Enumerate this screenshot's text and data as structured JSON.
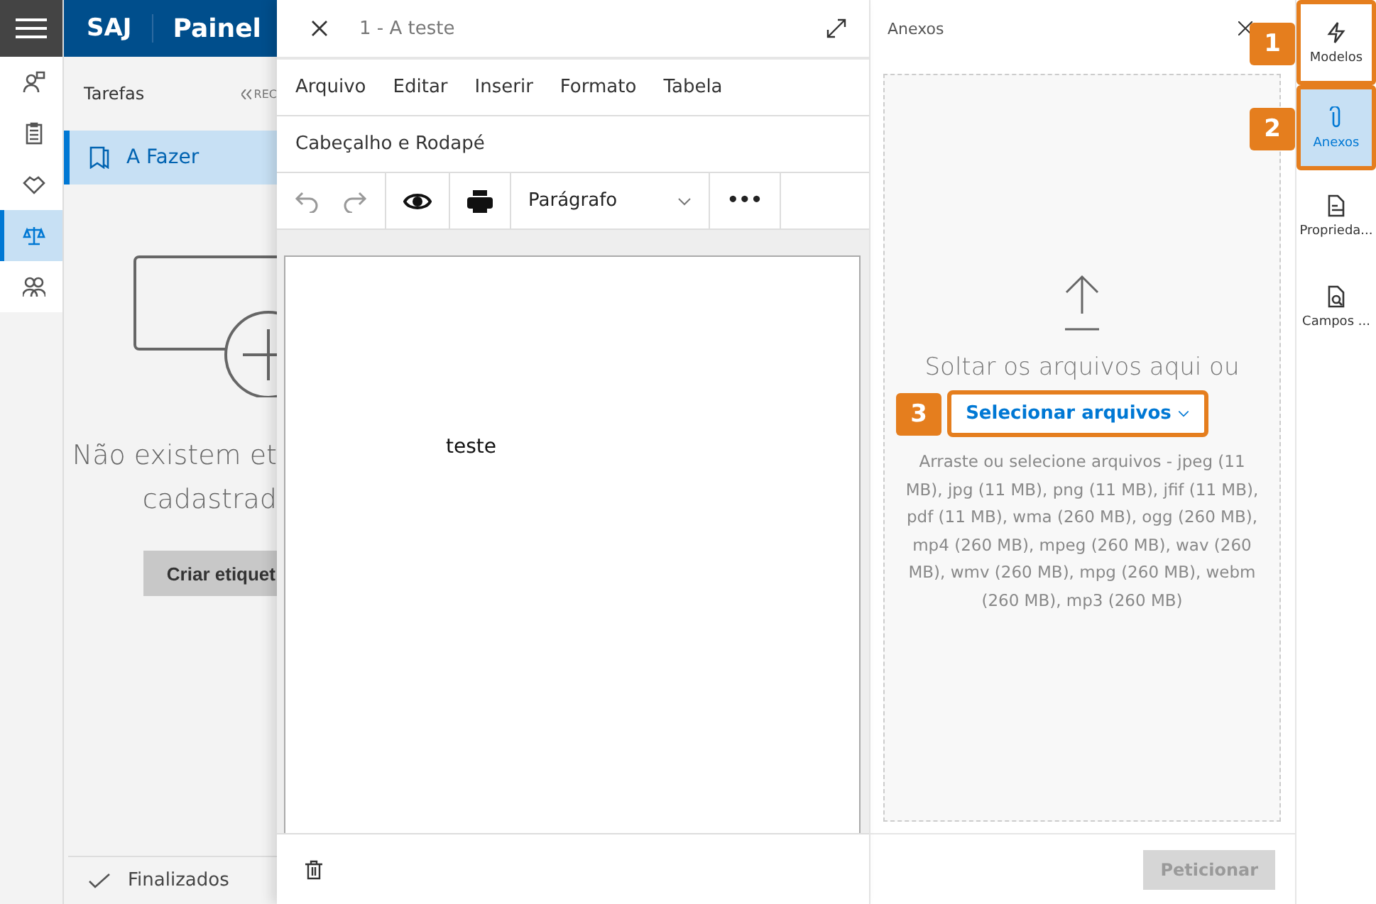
{
  "nav_rail": {
    "items": [
      {
        "kind": "person",
        "selected": false
      },
      {
        "kind": "clipboard",
        "selected": false
      },
      {
        "kind": "handshake",
        "selected": false
      },
      {
        "kind": "scales",
        "selected": true
      },
      {
        "kind": "people",
        "selected": false
      }
    ]
  },
  "header": {
    "logo": "SAJ",
    "title": "Painel"
  },
  "tasks_panel": {
    "title": "Tarefas",
    "collapse": "REC",
    "items": [
      {
        "label": "A Fazer",
        "selected": true
      }
    ],
    "empty_message": [
      "Não existem et",
      "cadastrad"
    ],
    "create_button": "Criar etiquet",
    "footer_item": "Finalizados"
  },
  "editor": {
    "title": "1 - A teste",
    "menu": [
      "Arquivo",
      "Editar",
      "Inserir",
      "Formato",
      "Tabela"
    ],
    "submenu": "Cabeçalho e Rodapé",
    "format_select": "Parágrafo",
    "more": "•••",
    "content": "teste"
  },
  "attachments": {
    "title": "Anexos",
    "drop_text": "Soltar os arquivos aqui ou",
    "select_button": "Selecionar arquivos",
    "hint": "Arraste ou selecione arquivos - jpeg (11 MB), jpg (11 MB), png (11 MB), jfif (11 MB), pdf (11 MB), wma (260 MB), ogg (260 MB), mp4 (260 MB), mpeg (260 MB), wav (260 MB), wmv (260 MB), mpg (260 MB), webm (260 MB), mp3 (260 MB)",
    "submit_button": "Peticionar",
    "submit_disabled": true
  },
  "side_tabs": [
    {
      "kind": "bolt",
      "label": "Modelos",
      "selected": false,
      "callout": "1"
    },
    {
      "kind": "clip",
      "label": "Anexos",
      "selected": true,
      "callout": "2"
    },
    {
      "kind": "doc",
      "label": "Proprieda...",
      "selected": false
    },
    {
      "kind": "search",
      "label": "Campos ...",
      "selected": false
    }
  ],
  "select_callout": "3"
}
